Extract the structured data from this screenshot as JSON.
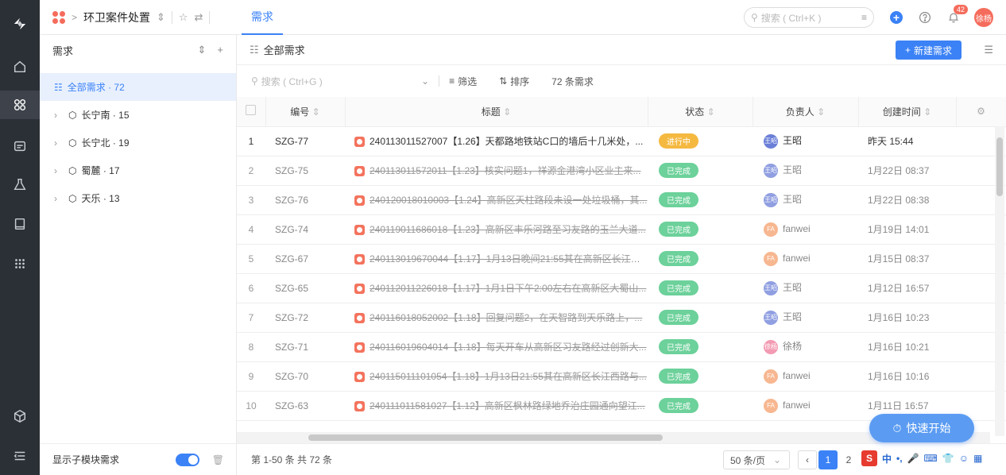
{
  "topbar": {
    "project_name": "环卫案件处置",
    "tab_label": "需求",
    "search_placeholder": "搜索 ( Ctrl+K )",
    "notification_count": "42",
    "user_avatar": "徐杨"
  },
  "sidebar": {
    "header": "需求",
    "items": [
      {
        "label": "全部需求 · 72"
      },
      {
        "label": "长宁南 · 15"
      },
      {
        "label": "长宁北 · 19"
      },
      {
        "label": "蜀麓 · 17"
      },
      {
        "label": "天乐 · 13"
      }
    ],
    "footer_label": "显示子模块需求"
  },
  "main": {
    "header_title": "全部需求",
    "new_button": "新建需求",
    "search_placeholder": "搜索 ( Ctrl+G )",
    "filter_label": "筛选",
    "sort_label": "排序",
    "count_label": "72 条需求",
    "columns": [
      "编号",
      "标题",
      "状态",
      "负责人",
      "创建时间"
    ],
    "rows": [
      {
        "no": "1",
        "id": "SZG-77",
        "title": "240113011527007【1.26】天都路地铁站C口的墙后十几米处，...",
        "status": "进行中",
        "owner": "王昭",
        "owner_abbr": "王昭",
        "time": "昨天 15:44"
      },
      {
        "no": "2",
        "id": "SZG-75",
        "title": "240113011572011【1.23】核实问题1，祥源金港湾小区业主来...",
        "status": "已完成",
        "owner": "王昭",
        "owner_abbr": "王昭",
        "time": "1月22日 08:37"
      },
      {
        "no": "3",
        "id": "SZG-76",
        "title": "240120018010003【1.24】高新区天柱路段未设一处垃圾桶，其...",
        "status": "已完成",
        "owner": "王昭",
        "owner_abbr": "王昭",
        "time": "1月22日 08:38"
      },
      {
        "no": "4",
        "id": "SZG-74",
        "title": "240119011686018【1.23】高新区丰乐河路至习友路的玉兰大道...",
        "status": "已完成",
        "owner": "fanwei",
        "owner_abbr": "FA",
        "time": "1月19日 14:01"
      },
      {
        "no": "5",
        "id": "SZG-67",
        "title": "240113019670044【1.17】1月13日晚间21:55其在高新区长江西...",
        "status": "已完成",
        "owner": "fanwei",
        "owner_abbr": "FA",
        "time": "1月15日 08:37"
      },
      {
        "no": "6",
        "id": "SZG-65",
        "title": "240112011226018【1.17】1月1日下午2:00左右在高新区大蜀山...",
        "status": "已完成",
        "owner": "王昭",
        "owner_abbr": "王昭",
        "time": "1月12日 16:57"
      },
      {
        "no": "7",
        "id": "SZG-72",
        "title": "240116018052002【1.18】回复问题2，在天智路到天乐路上，...",
        "status": "已完成",
        "owner": "王昭",
        "owner_abbr": "王昭",
        "time": "1月16日 10:23"
      },
      {
        "no": "8",
        "id": "SZG-71",
        "title": "240116019604014【1.18】每天开车从高新区习友路经过创新大...",
        "status": "已完成",
        "owner": "徐杨",
        "owner_abbr": "徐杨",
        "time": "1月16日 10:21"
      },
      {
        "no": "9",
        "id": "SZG-70",
        "title": "240115011101054【1.18】1月13日21:55其在高新区长江西路与...",
        "status": "已完成",
        "owner": "fanwei",
        "owner_abbr": "FA",
        "time": "1月16日 10:16"
      },
      {
        "no": "10",
        "id": "SZG-63",
        "title": "240111011581027【1.12】高新区枫林路绿地乔治庄园通向望江...",
        "status": "已完成",
        "owner": "fanwei",
        "owner_abbr": "FA",
        "time": "1月11日 16:57"
      }
    ]
  },
  "pager": {
    "range_label": "第 1-50 条  共 72 条",
    "page_size": "50 条/页",
    "page1": "1",
    "page2": "2"
  },
  "quick_start": "快速开始",
  "colors": {
    "accent": "#3b82f6",
    "done": "#6cd19a",
    "progress": "#f5b940",
    "sidebar_dark": "#2b2f36"
  }
}
